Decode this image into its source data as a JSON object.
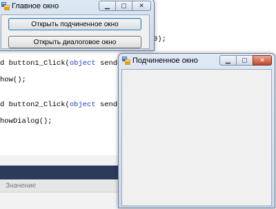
{
  "code": {
    "line_b1": {
      "pre": "d button1_Click(",
      "kw": "object",
      "post": " sender, E"
    },
    "line_show": "how();",
    "line_b2": {
      "pre": "d button2_Click(",
      "kw": "object",
      "post": " sender, E"
    },
    "line_showdialog": "howDialog();",
    "frag_right": "0);"
  },
  "properties": {
    "column_label": "Значение"
  },
  "main_window": {
    "title": "Главное окно",
    "button_open_child": "Открыть подчиненное окно",
    "button_open_dialog": "Открыть диалоговое окно"
  },
  "child_window": {
    "title": "Подчиненное окно"
  },
  "controls": {
    "minimize": "▁",
    "maximize": "▢",
    "close": "✕"
  },
  "colors": {
    "close_red": "#c4442a",
    "title_bg": "#dfe9f5",
    "client_bg": "#f0f0f0"
  }
}
